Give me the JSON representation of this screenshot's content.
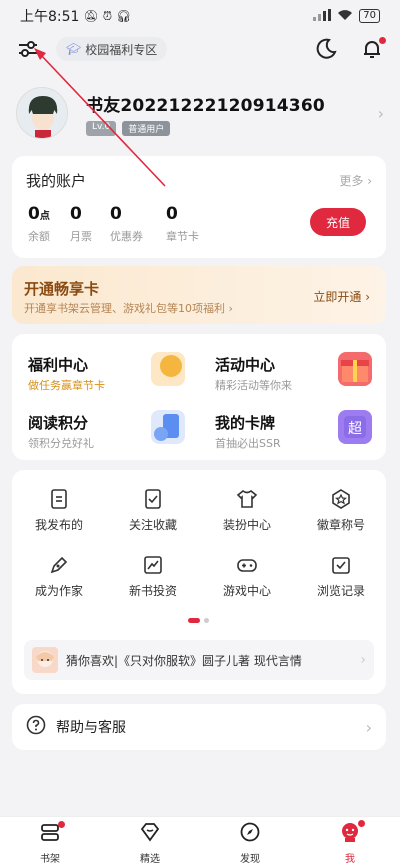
{
  "status": {
    "time": "上午8:51",
    "battery": "70"
  },
  "topbar": {
    "campus_label": "校园福利专区"
  },
  "profile": {
    "username": "书友20221222120914360",
    "level": "Lv.0",
    "user_type": "普通用户"
  },
  "account": {
    "title": "我的账户",
    "more": "更多",
    "stats": [
      {
        "value": "0",
        "unit": "点",
        "label": "余额"
      },
      {
        "value": "0",
        "unit": "",
        "label": "月票"
      },
      {
        "value": "0",
        "unit": "",
        "label": "优惠券"
      },
      {
        "value": "0",
        "unit": "",
        "label": "章节卡"
      }
    ],
    "recharge": "充值"
  },
  "vip": {
    "title": "开通畅享卡",
    "desc": "开通享书架云管理、游戏礼包等10项福利",
    "open": "立即开通"
  },
  "welfare": [
    {
      "title": "福利中心",
      "sub": "做任务赢章节卡"
    },
    {
      "title": "活动中心",
      "sub": "精彩活动等你来"
    },
    {
      "title": "阅读积分",
      "sub": "领积分兑好礼"
    },
    {
      "title": "我的卡牌",
      "sub": "首抽必出SSR"
    }
  ],
  "grid": [
    {
      "label": "我发布的",
      "icon": "document-icon"
    },
    {
      "label": "关注收藏",
      "icon": "bookmark-check-icon"
    },
    {
      "label": "装扮中心",
      "icon": "shirt-icon"
    },
    {
      "label": "徽章称号",
      "icon": "badge-icon"
    },
    {
      "label": "成为作家",
      "icon": "pen-icon"
    },
    {
      "label": "新书投资",
      "icon": "chart-icon"
    },
    {
      "label": "游戏中心",
      "icon": "gamepad-icon"
    },
    {
      "label": "浏览记录",
      "icon": "history-icon"
    }
  ],
  "recommend": {
    "text": "猜你喜欢|《只对你服软》圆子儿著 现代言情"
  },
  "help": {
    "label": "帮助与客服"
  },
  "tabs": [
    {
      "label": "书架",
      "active": false
    },
    {
      "label": "精选",
      "active": false
    },
    {
      "label": "发现",
      "active": false
    },
    {
      "label": "我",
      "active": true
    }
  ],
  "colors": {
    "accent": "#e0283e",
    "vip_text": "#8a4a12",
    "background": "#f3f3f5"
  }
}
